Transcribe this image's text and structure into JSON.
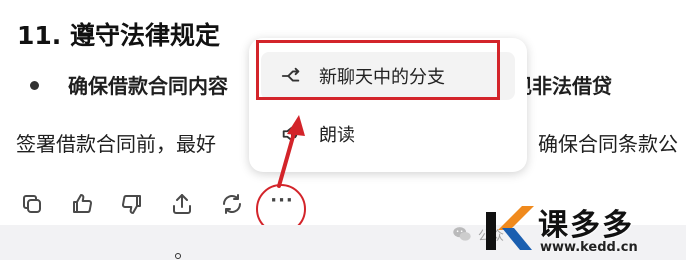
{
  "article": {
    "heading": "11. 遵守法律规定",
    "bullet_text": "确保借款合同内容符合法律法规，避免出现非法借贷",
    "bullet_visible_left": "确保借款合同内容",
    "bullet_visible_right": "免出现非法借贷",
    "paragraph_visible_left": "签署借款合同前，最好",
    "paragraph_visible_right": "确保合同条款公"
  },
  "toolbar": {
    "buttons": [
      {
        "name": "copy",
        "icon": "copy-icon"
      },
      {
        "name": "thumbs-up",
        "icon": "thumbs-up-icon"
      },
      {
        "name": "thumbs-down",
        "icon": "thumbs-down-icon"
      },
      {
        "name": "share",
        "icon": "share-icon"
      },
      {
        "name": "regenerate",
        "icon": "refresh-icon"
      },
      {
        "name": "more",
        "icon": "more-icon",
        "label": "···"
      }
    ]
  },
  "menu": {
    "items": [
      {
        "label": "新聊天中的分支",
        "icon": "branch-icon"
      },
      {
        "label": "朗读",
        "icon": "speaker-icon"
      }
    ]
  },
  "watermark": {
    "wechat_text": "公众",
    "brand_name": "课多多",
    "brand_url": "www.kedd.cn"
  },
  "colors": {
    "annotation_red": "#d3242a",
    "brand_orange": "#f08a1d",
    "brand_blue": "#1b5fb0"
  }
}
